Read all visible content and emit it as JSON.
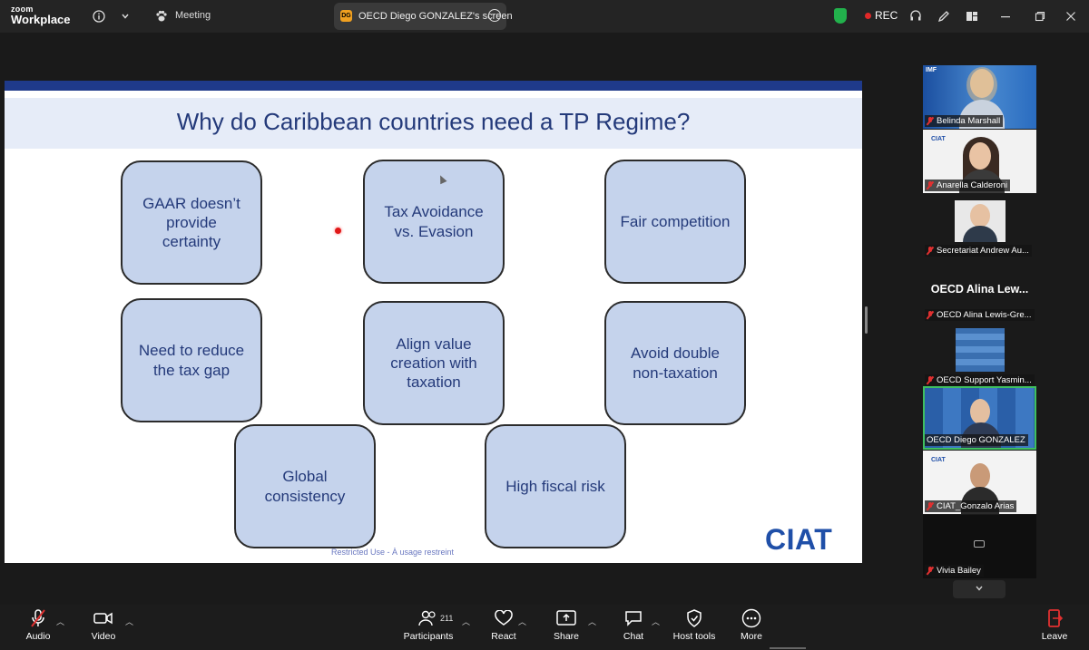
{
  "titlebar": {
    "logo_top": "zoom",
    "logo_bottom": "Workplace",
    "meeting_label": "Meeting",
    "screen_badge": "DG",
    "screen_tab_label": "OECD Diego GONZALEZ's screen",
    "rec_label": "REC"
  },
  "slide": {
    "title": "Why do Caribbean countries need a TP Regime?",
    "boxes": [
      "GAAR doesn’t\nprovide\ncertainty",
      "Tax Avoidance\nvs. Evasion",
      "Fair competition",
      "Need to reduce\nthe tax gap",
      "Align value\ncreation with\ntaxation",
      "Avoid double\nnon-taxation",
      "Global\nconsistency",
      "High fiscal risk"
    ],
    "logo": "CIAT",
    "footer": "Restricted Use - À usage restreint"
  },
  "participants": {
    "tiles": [
      {
        "name": "Belinda Marshall",
        "label_top": "IMF"
      },
      {
        "name": "Anarella Calderoni",
        "label_top": "CIAT"
      },
      {
        "name": "Secretariat Andrew Au..."
      },
      {
        "name": "OECD Alina Lewis-Gre..."
      },
      {
        "name": "OECD Support Yasmin..."
      },
      {
        "name": "OECD Diego GONZALEZ"
      },
      {
        "name": "CIAT_Gonzalo Arias",
        "label_top": "CIAT"
      },
      {
        "name": "Vivia Bailey"
      }
    ],
    "name_only": "OECD Alina Lew...",
    "colors": {
      "active_border": "#3fbf5f",
      "muted": "#e03030"
    }
  },
  "toolbar": {
    "audio": "Audio",
    "video": "Video",
    "participants": "Participants",
    "participant_count": "211",
    "react": "React",
    "share": "Share",
    "chat": "Chat",
    "host_tools": "Host tools",
    "more": "More",
    "leave": "Leave"
  }
}
